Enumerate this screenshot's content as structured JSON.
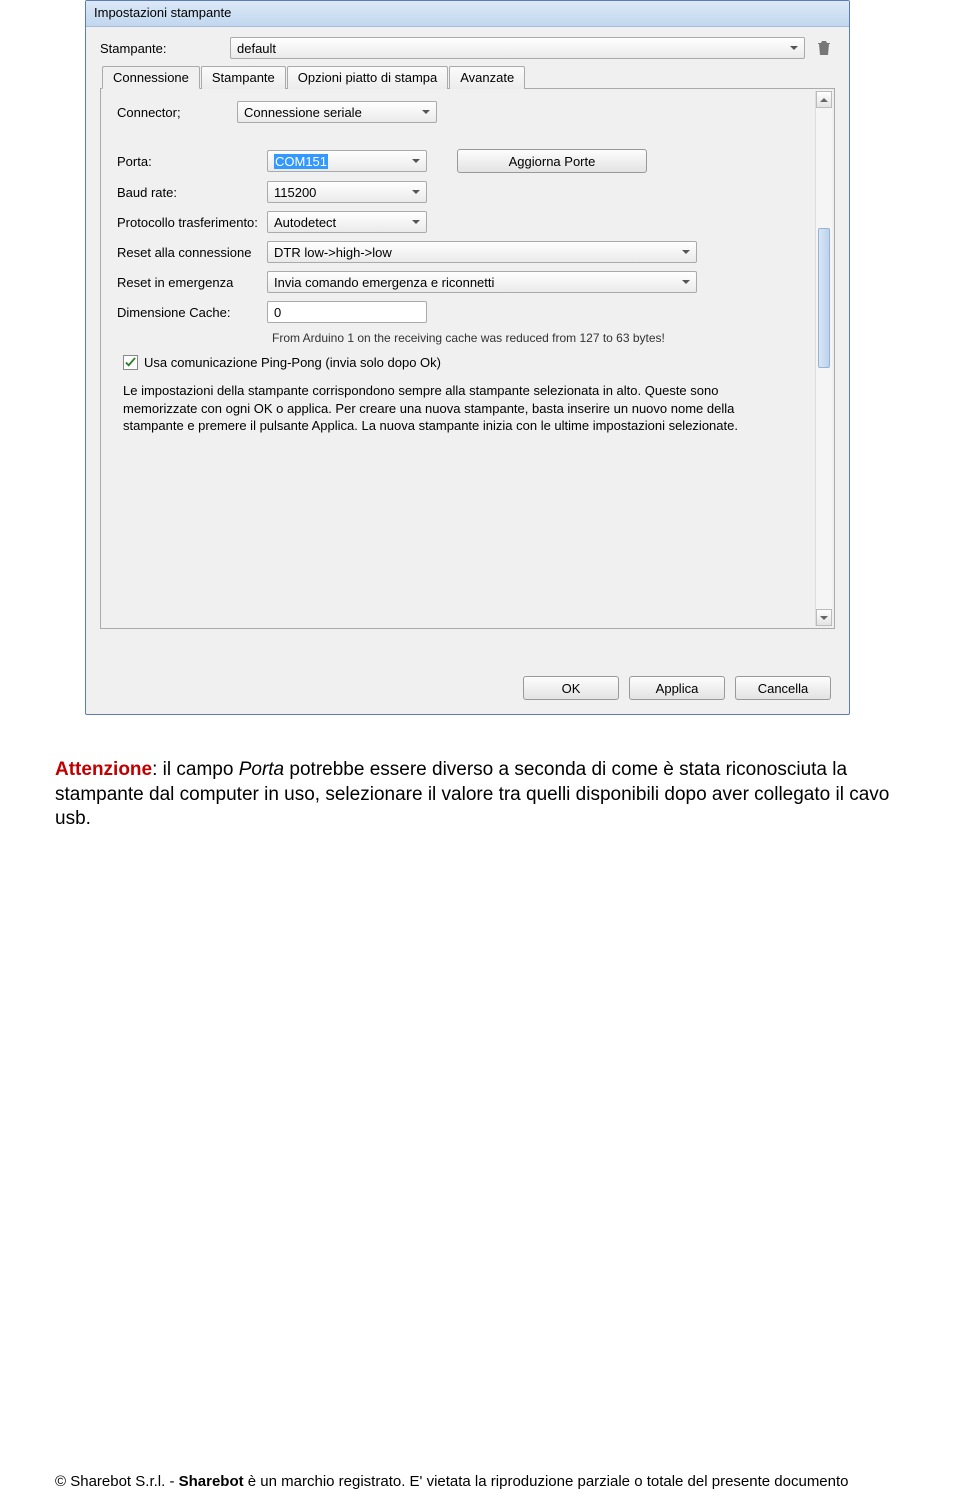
{
  "dialog": {
    "title": "Impostazioni stampante",
    "printer_label": "Stampante:",
    "printer_value": "default"
  },
  "tabs": {
    "connessione": "Connessione",
    "stampante": "Stampante",
    "opzioni": "Opzioni piatto di stampa",
    "avanzate": "Avanzate"
  },
  "conn": {
    "connector_label": "Connector;",
    "connector_value": "Connessione seriale",
    "porta_label": "Porta:",
    "porta_value": "COM151",
    "aggiorna": "Aggiorna Porte",
    "baud_label": "Baud rate:",
    "baud_value": "115200",
    "proto_label": "Protocollo trasferimento:",
    "proto_value": "Autodetect",
    "reset_label": "Reset alla connessione",
    "reset_value": "DTR low->high->low",
    "emerg_label": "Reset in emergenza",
    "emerg_value": "Invia comando emergenza e riconnetti",
    "cache_label": "Dimensione Cache:",
    "cache_value": "0",
    "hint": "From Arduino 1 on the receiving cache was reduced from 127 to 63 bytes!",
    "pingpong": "Usa comunicazione Ping-Pong (invia solo dopo Ok)",
    "desc": "Le impostazioni della stampante corrispondono sempre alla stampante selezionata in alto. Queste sono memorizzate con ogni OK o applica. Per creare una nuova stampante, basta inserire un nuovo nome della stampante e premere il pulsante Applica. La nuova stampante inizia con le ultime impostazioni selezionate."
  },
  "footer": {
    "ok": "OK",
    "applica": "Applica",
    "cancella": "Cancella"
  },
  "doc": {
    "attn": "Attenzione",
    "text1": ": il campo ",
    "porta": "Porta",
    "text2": " potrebbe essere diverso a seconda di come è stata riconosciuta la stampante dal computer in uso, selezionare il valore tra quelli disponibili dopo aver collegato il cavo usb."
  },
  "copyright": {
    "p1": "© Sharebot S.r.l. - ",
    "p2": "Sharebot",
    "p3": " è un marchio registrato. E' vietata la riproduzione parziale o totale del presente documento"
  }
}
